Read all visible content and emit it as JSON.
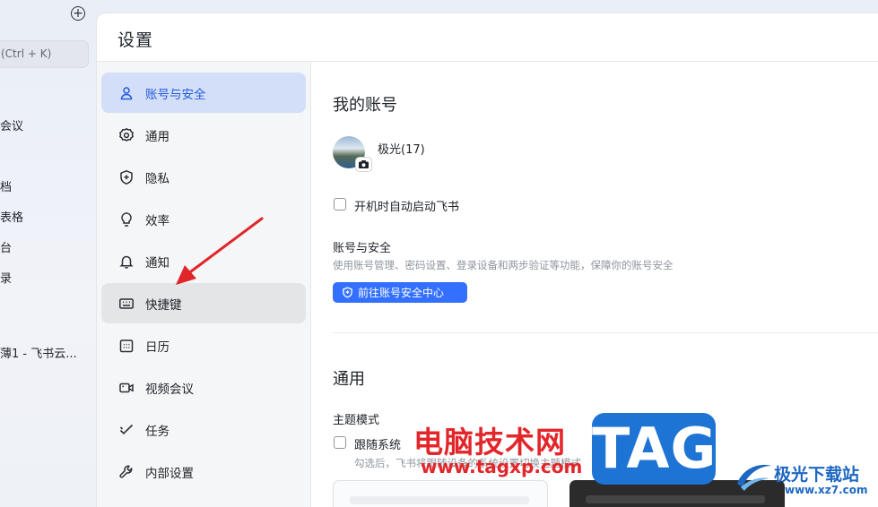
{
  "app_sidebar": {
    "search_hint": "(Ctrl + K)",
    "items": [
      "会议",
      "档",
      "表格",
      "台",
      "录",
      "薄1 - 飞书云..."
    ]
  },
  "settings": {
    "title": "设置",
    "menu": [
      {
        "label": "账号与安全",
        "icon": "user-icon",
        "active": true
      },
      {
        "label": "通用",
        "icon": "gear-icon"
      },
      {
        "label": "隐私",
        "icon": "shield-plus-icon"
      },
      {
        "label": "效率",
        "icon": "lightbulb-icon"
      },
      {
        "label": "通知",
        "icon": "bell-icon"
      },
      {
        "label": "快捷键",
        "icon": "keyboard-icon",
        "hover": true
      },
      {
        "label": "日历",
        "icon": "calendar-icon"
      },
      {
        "label": "视频会议",
        "icon": "video-camera-icon"
      },
      {
        "label": "任务",
        "icon": "task-check-icon"
      },
      {
        "label": "内部设置",
        "icon": "wrench-icon"
      }
    ],
    "account": {
      "heading": "我的账号",
      "username": "极光(17)",
      "autostart_label": "开机时自动启动飞书",
      "security_title": "账号与安全",
      "security_desc": "使用账号管理、密码设置、登录设备和两步验证等功能，保障你的账号安全",
      "security_button": "前往账号安全中心"
    },
    "general": {
      "heading": "通用",
      "theme_title": "主题模式",
      "follow_system_label": "跟随系统",
      "follow_system_desc": "勾选后，飞书将跟随设备的系统设置切换主题模式"
    }
  },
  "colors": {
    "accent": "#3370ff",
    "active_menu_bg": "#d3dff8",
    "annotation_arrow": "#e0262a"
  },
  "watermarks": {
    "cn_text": "电脑技术网",
    "url": "www.tagxp.com",
    "tag": "TAG",
    "logo_text": "极光下载站",
    "logo_url": "www.xz7.com"
  }
}
